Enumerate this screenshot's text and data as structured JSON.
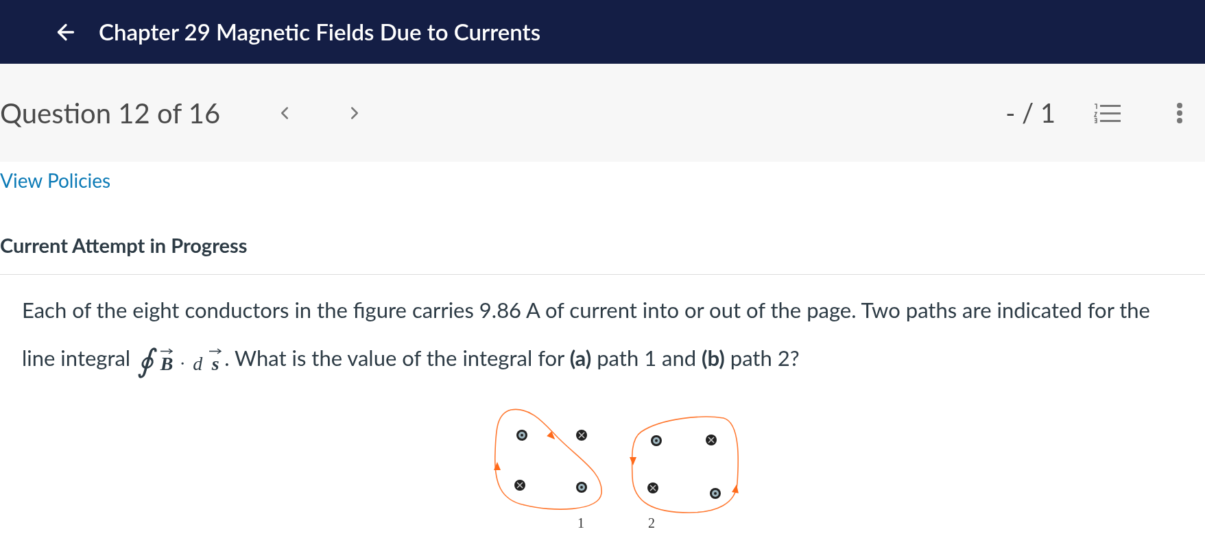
{
  "header": {
    "title": "Chapter 29 Magnetic Fields Due to Currents"
  },
  "question_bar": {
    "label": "Question 12 of 16",
    "score": "- / 1"
  },
  "policies_link": "View Policies",
  "attempt_heading": "Current Attempt in Progress",
  "question": {
    "line1": "Each of the eight conductors in the figure carries 9.86 A of current into or out of the page. Two paths are indicated for the",
    "line2_prefix": "line integral",
    "formula": {
      "symbol": "∮",
      "terms": [
        {
          "text": "B",
          "vector": true
        },
        {
          "text": "·",
          "vector": false
        },
        {
          "text": "d",
          "vector": false
        },
        {
          "text": "s",
          "vector": true
        }
      ]
    },
    "line2_suffix": ". What is the value of the integral for **(a)** path 1 and **(b)** path 2?"
  },
  "figure": {
    "paths": [
      {
        "label": "1"
      },
      {
        "label": "2"
      }
    ],
    "conductors": [
      {
        "kind": "out"
      },
      {
        "kind": "in"
      },
      {
        "kind": "in"
      },
      {
        "kind": "out"
      },
      {
        "kind": "out"
      },
      {
        "kind": "in"
      },
      {
        "kind": "in"
      },
      {
        "kind": "out"
      }
    ]
  }
}
